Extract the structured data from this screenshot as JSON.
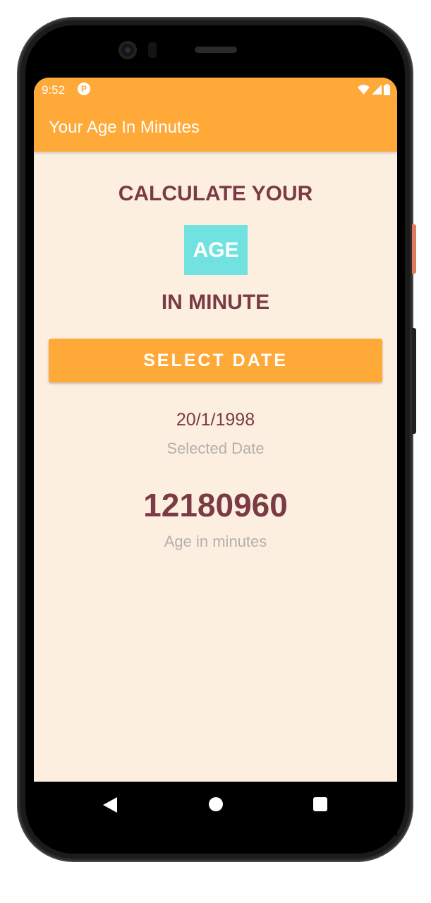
{
  "status_bar": {
    "time": "9:52",
    "app_icon_glyph": "P",
    "icons": [
      "wifi-icon",
      "signal-icon",
      "battery-icon"
    ]
  },
  "app_bar": {
    "title": "Your Age In Minutes"
  },
  "main": {
    "heading_top": "CALCULATE YOUR",
    "heading_badge": "AGE",
    "heading_bottom": "IN MINUTE",
    "select_button_label": "SELECT DATE",
    "selected_date_value": "20/1/1998",
    "selected_date_label": "Selected Date",
    "age_minutes_value": "12180960",
    "age_minutes_label": "Age in minutes"
  },
  "nav_bar": {
    "items": [
      "back-icon",
      "home-icon",
      "recents-icon"
    ]
  },
  "colors": {
    "primary": "#ffa938",
    "background": "#fdefdf",
    "text_primary": "#7b3b44",
    "text_secondary": "#b4b0ac",
    "accent": "#72e2e0"
  }
}
